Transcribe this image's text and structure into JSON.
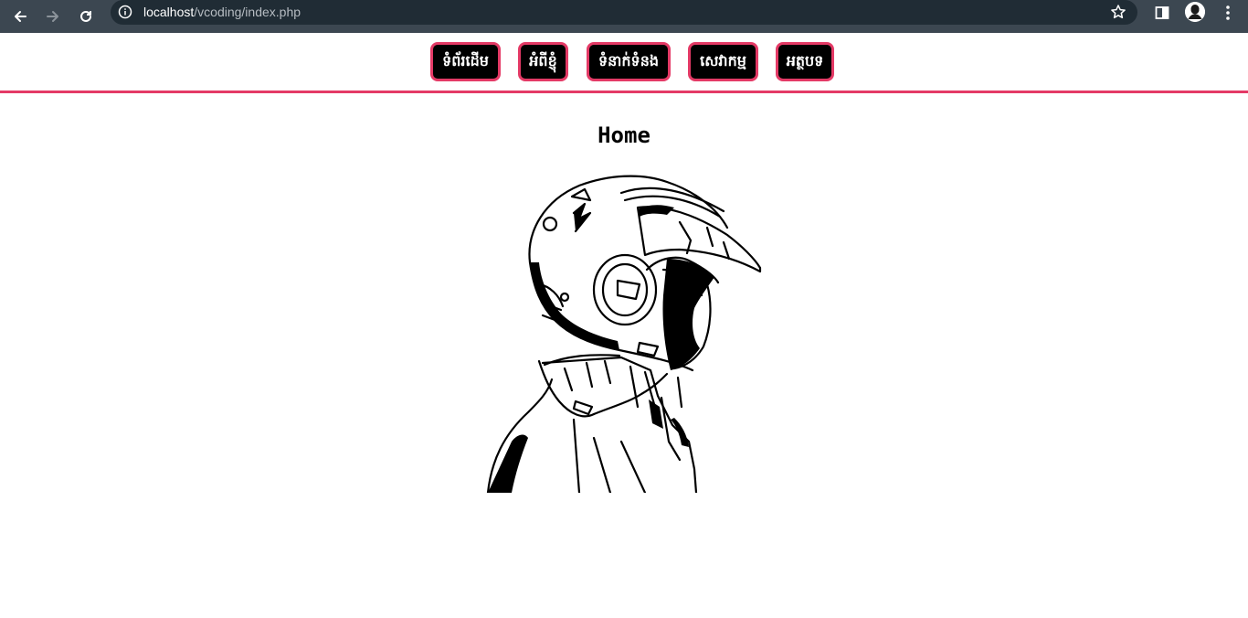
{
  "browser": {
    "url_host": "localhost",
    "url_path": "/vcoding/index.php",
    "icons": [
      "back-arrow-icon",
      "forward-arrow-icon",
      "reload-icon",
      "info-icon",
      "star-icon",
      "side-panel-icon",
      "profile-avatar-icon",
      "kebab-menu-icon"
    ]
  },
  "nav": {
    "items": [
      {
        "label": "ទំព័រដើម"
      },
      {
        "label": "អំពីខ្ញុំ"
      },
      {
        "label": "ទំនាក់ទំនង"
      },
      {
        "label": "សេវាកម្ម"
      },
      {
        "label": "អត្ថបទ"
      }
    ],
    "accent_color": "#e43a66",
    "button_bg": "#000000"
  },
  "main": {
    "title": "Home"
  }
}
